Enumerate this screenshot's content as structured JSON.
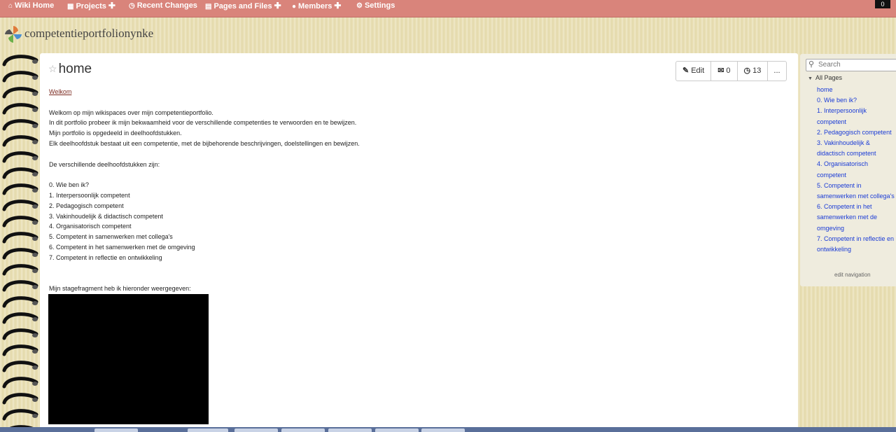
{
  "topnav": {
    "items": [
      {
        "label": "Wiki Home",
        "icon": "home-icon",
        "plus": false
      },
      {
        "label": "Projects",
        "icon": "sitemap-icon",
        "plus": true
      },
      {
        "label": "Recent Changes",
        "icon": "clock-icon",
        "plus": false
      },
      {
        "label": "Pages and Files",
        "icon": "file-icon",
        "plus": true
      },
      {
        "label": "Members",
        "icon": "user-icon",
        "plus": true
      },
      {
        "label": "Settings",
        "icon": "gear-icon",
        "plus": false
      }
    ],
    "user_badge": "0"
  },
  "header": {
    "site_title": "competentieportfolionynke",
    "logo_icon": "pinwheel-logo"
  },
  "page": {
    "title": "home",
    "actions": {
      "edit": "Edit",
      "comments": "0",
      "history": "13",
      "more": "..."
    },
    "content": {
      "welkom_link": "Welkom",
      "intro": [
        "Welkom op mijn wikispaces over mijn competentieportfolio.",
        "In dit portfolio probeer ik mijn bekwaamheid voor de verschillende competenties te verwoorden en te bewijzen.",
        "Mijn portfolio is opgedeeld in deelhoofdstukken.",
        "Elk deelhoofdstuk bestaat uit een competentie, met de bijbehorende beschrijvingen, doelstellingen en bewijzen."
      ],
      "list_intro": "De verschillende deelhoofdstukken zijn:",
      "chapters": [
        "0. Wie ben ik?",
        "1. Interpersoonlijk competent",
        "2. Pedagogisch competent",
        "3. Vakinhoudelijk & didactisch competent",
        "4. Organisatorisch competent",
        "5. Competent in samenwerken met collega's",
        "6. Competent in het samenwerken met de omgeving",
        "7. Competent in reflectie en ontwikkeling"
      ],
      "stage_text": "Mijn stagefragment heb ik hieronder weergegeven:"
    }
  },
  "sidebar": {
    "search_placeholder": "Search",
    "all_pages": "All Pages",
    "pages": [
      "home",
      "0. Wie ben ik?",
      "1. Interpersoonlijk competent",
      "2. Pedagogisch competent",
      "3. Vakinhoudelijk & didactisch competent",
      "4. Organisatorisch competent",
      "5. Competent in samenwerken met collega's",
      "6. Competent in het samenwerken met de omgeving",
      "7. Competent in reflectie en ontwikkeling"
    ],
    "edit_navigation": "edit navigation"
  },
  "colors": {
    "topbar": "#d9847b",
    "link": "#1a3bd6",
    "welkom": "#7b2a20"
  }
}
